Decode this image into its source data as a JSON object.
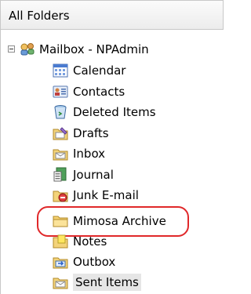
{
  "header": {
    "title": "All Folders"
  },
  "tree": {
    "root_label": "Mailbox - NPAdmin",
    "items": [
      {
        "label": "Calendar",
        "icon": "calendar-icon"
      },
      {
        "label": "Contacts",
        "icon": "contacts-icon"
      },
      {
        "label": "Deleted Items",
        "icon": "deleted-items-icon"
      },
      {
        "label": "Drafts",
        "icon": "drafts-icon"
      },
      {
        "label": "Inbox",
        "icon": "inbox-icon"
      },
      {
        "label": "Journal",
        "icon": "journal-icon"
      },
      {
        "label": "Junk E-mail",
        "icon": "junk-email-icon"
      },
      {
        "label": "Mimosa Archive",
        "icon": "folder-icon"
      },
      {
        "label": "Notes",
        "icon": "notes-icon"
      },
      {
        "label": "Outbox",
        "icon": "outbox-icon"
      },
      {
        "label": "Sent Items",
        "icon": "sent-items-icon"
      }
    ],
    "selected": "Sent Items"
  },
  "colors": {
    "highlight_ring": "#e0282a",
    "header_border": "#c8c8c8",
    "selected_bg": "#e6e6e6"
  }
}
